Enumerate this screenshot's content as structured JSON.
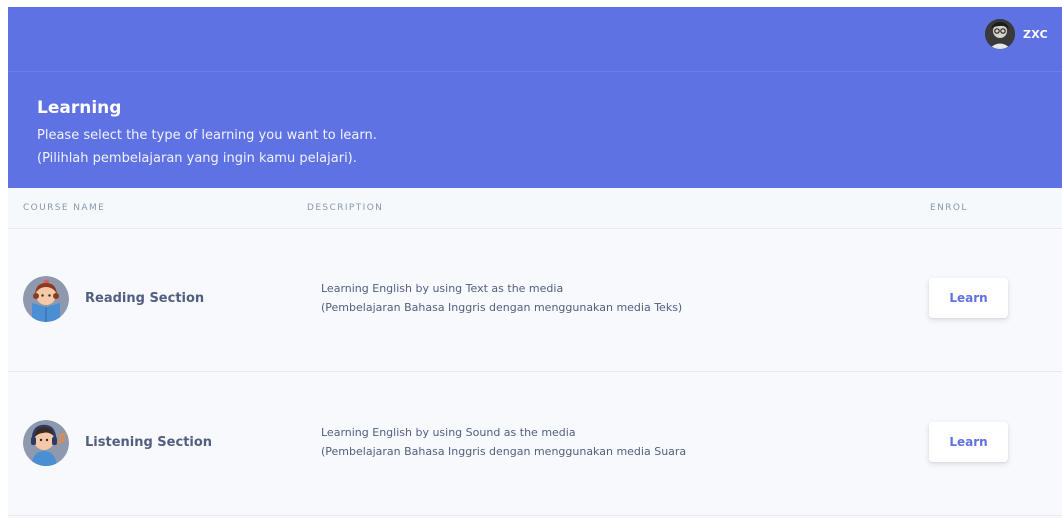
{
  "colors": {
    "primary": "#5e72e4",
    "text": "#525f7f",
    "muted": "#8898aa",
    "background": "#f7f9fc"
  },
  "user": {
    "name": "ZXC",
    "avatar_icon": "user-avatar-photo"
  },
  "header": {
    "title": "Learning",
    "subtitle_en": "Please select the type of learning you want to learn.",
    "subtitle_id": "(Pilihlah pembelajaran yang ingin kamu pelajari)."
  },
  "table": {
    "columns": [
      "COURSE NAME",
      "DESCRIPTION",
      "ENROL"
    ],
    "rows": [
      {
        "icon": "reading-girl-icon",
        "name": "Reading Section",
        "desc_en": "Learning English by using Text as the media",
        "desc_id": "(Pembelajaran Bahasa Inggris dengan menggunakan media Teks)",
        "button": "Learn"
      },
      {
        "icon": "listening-boy-icon",
        "name": "Listening Section",
        "desc_en": "Learning English by using Sound as the media",
        "desc_id": "(Pembelajaran Bahasa Inggris dengan menggunakan media Suara",
        "button": "Learn"
      }
    ]
  }
}
